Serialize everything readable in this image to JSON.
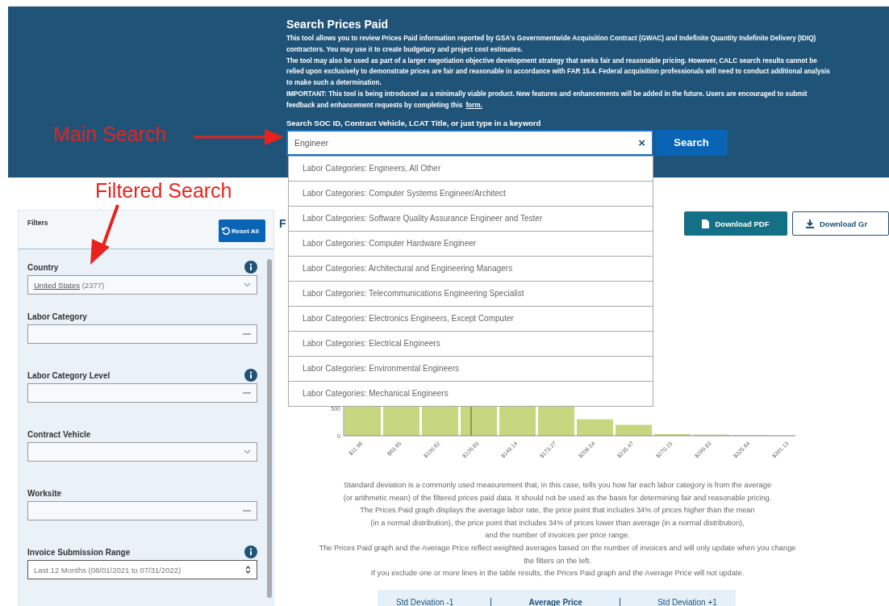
{
  "annotations": [
    {
      "text": "Main Search",
      "kind": "main"
    },
    {
      "text": "Filtered Search",
      "kind": "filter"
    }
  ],
  "banner": {
    "title": "Search Prices Paid",
    "paragraphs": [
      "This tool allows you to review Prices Paid information reported by GSA's Governmentwide Acquisition Contract (GWAC) and Indefinite Quantity Indefinite Delivery (IDIQ) contractors. You may use it to create budgetary and project cost estimates.",
      "The tool may also be used as part of a larger negotiation objective development strategy that seeks fair and reasonable pricing. However, CALC search results cannot be relied upon exclusively to demonstrate prices are fair and reasonable in accordance with FAR 15.4. Federal acquisition professionals will need to conduct additional analysis to make such a determination."
    ],
    "notice": "IMPORTANT: This tool is being introduced as a minimally viable product. New features and enhancements will be added in the future. Users are encouraged to submit feedback and enhancement requests by completing this",
    "notice_link": "form.",
    "search_label": "Search SOC ID, Contract Vehicle, LCAT Title, or just type in a keyword",
    "search_value": "Engineer",
    "clear": "×",
    "search_button": "Search",
    "suggestions": [
      "Labor Categories: Engineers, All Other",
      "Labor Categories: Computer Systems Engineer/Architect",
      "Labor Categories: Software Quality Assurance Engineer and Tester",
      "Labor Categories: Computer Hardware Engineer",
      "Labor Categories: Architectural and Engineering Managers",
      "Labor Categories: Telecommunications Engineering Specialist",
      "Labor Categories: Electronics Engineers, Except Computer",
      "Labor Categories: Electrical Engineers",
      "Labor Categories: Environmental Engineers",
      "Labor Categories: Mechanical Engineers"
    ]
  },
  "filters": {
    "title": "Filters",
    "reset_button": "Reset All",
    "fields": [
      {
        "label": "Country",
        "kind": "select",
        "info": true,
        "value": "United States",
        "count": "(2377)"
      },
      {
        "label": "Labor Category",
        "kind": "multi",
        "info": false
      },
      {
        "label": "Labor Category Level",
        "kind": "multi",
        "info": true
      },
      {
        "label": "Contract Vehicle",
        "kind": "select",
        "info": false
      },
      {
        "label": "Worksite",
        "kind": "multi",
        "info": false
      },
      {
        "label": "Invoice Submission Range",
        "kind": "range",
        "info": true,
        "value": "Last 12 Months (08/01/2021 to 07/31/2022)"
      }
    ]
  },
  "results": {
    "title": "F",
    "buttons": [
      {
        "label": "Download PDF",
        "kind": "filled"
      },
      {
        "label": "Download Gr",
        "kind": "outline"
      }
    ],
    "chart": {
      "y_labels": [
        "500",
        "0"
      ],
      "x_labels": [
        "$11.96",
        "$63.65",
        "$100.62",
        "$126.83",
        "$149.14",
        "$173.27",
        "$206.54",
        "$235.47",
        "$270.15",
        "$299.83",
        "$325.64",
        "$391.13"
      ]
    },
    "help_lines": [
      "Standard deviation is a commonly used measurement that, in this case, tells you how far each labor category is from the average",
      "(or arithmetic mean) of the filtered prices paid data. It should not be used as the basis for determining fair and reasonable pricing.",
      "The Prices Paid graph displays the average labor rate, the price point that includes 34% of prices higher than the mean",
      "(in a normal distribution), the price point that includes 34% of prices lower than average (in a normal distribution),",
      "and the number of invoices per price range.",
      "The Prices Paid graph and the Average Price reflect weighted averages based on the number of invoices and will only update when you change",
      "the filters on the left.",
      "If you exclude one or more lines in the table results, the Prices Paid graph and the Average Price will not update."
    ],
    "stats": [
      {
        "label": "Std Deviation -1",
        "kind": "side"
      },
      {
        "label": "Average Price",
        "kind": "center"
      },
      {
        "label": "Std Deviation +1",
        "kind": "side"
      }
    ]
  }
}
